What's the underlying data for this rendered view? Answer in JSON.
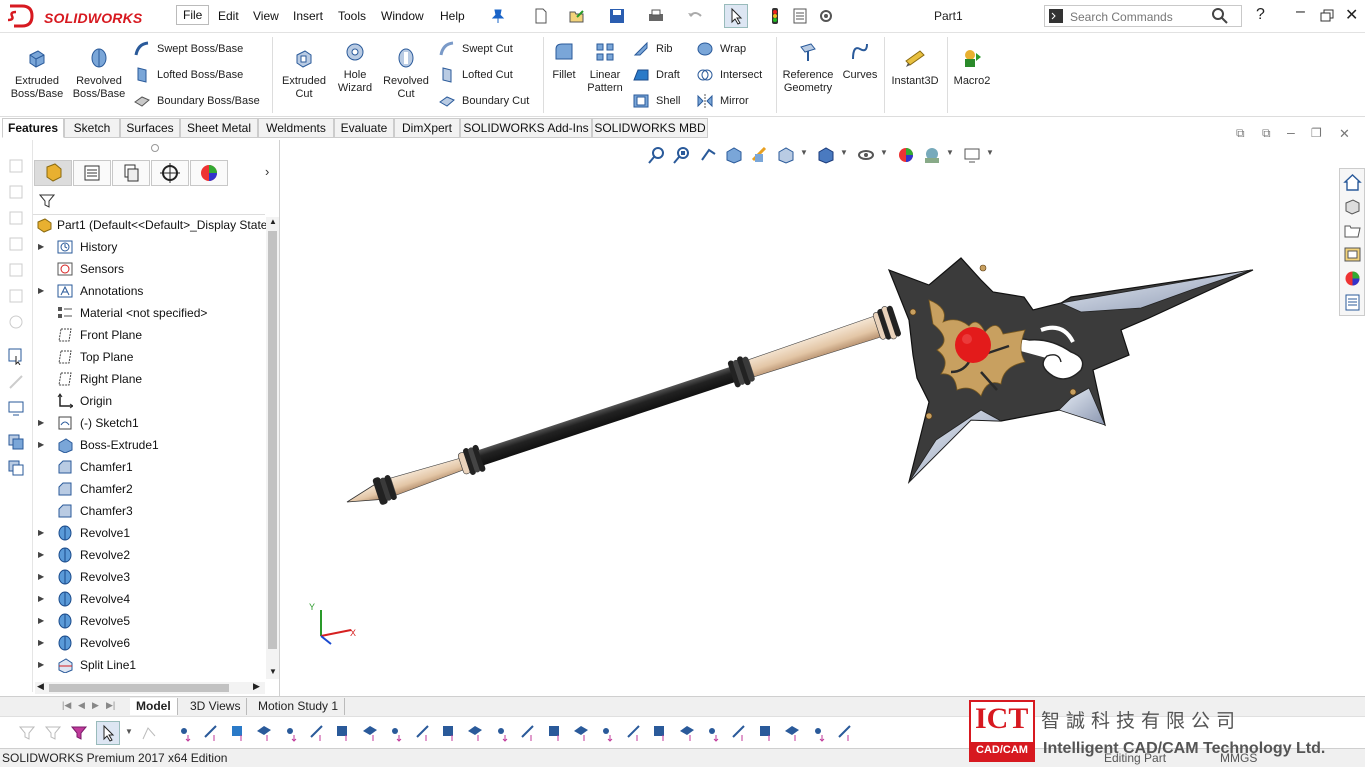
{
  "app": {
    "brand": "SOLIDWORKS",
    "document_title": "Part1",
    "edition": "SOLIDWORKS Premium 2017 x64 Edition",
    "status_mode": "Editing Part",
    "units": "MMGS"
  },
  "menu": [
    "File",
    "Edit",
    "View",
    "Insert",
    "Tools",
    "Window",
    "Help"
  ],
  "search": {
    "placeholder": "Search Commands"
  },
  "ribbon": {
    "extruded_boss": "Extruded Boss/Base",
    "revolved_boss": "Revolved Boss/Base",
    "swept_boss": "Swept Boss/Base",
    "lofted_boss": "Lofted Boss/Base",
    "boundary_boss": "Boundary Boss/Base",
    "extruded_cut": "Extruded Cut",
    "hole_wizard": "Hole Wizard",
    "revolved_cut": "Revolved Cut",
    "swept_cut": "Swept Cut",
    "lofted_cut": "Lofted Cut",
    "boundary_cut": "Boundary Cut",
    "fillet": "Fillet",
    "linear_pattern": "Linear Pattern",
    "rib": "Rib",
    "draft": "Draft",
    "shell": "Shell",
    "wrap": "Wrap",
    "intersect": "Intersect",
    "mirror": "Mirror",
    "reference_geometry": "Reference Geometry",
    "curves": "Curves",
    "instant3d": "Instant3D",
    "macro2": "Macro2"
  },
  "tabs": [
    "Features",
    "Sketch",
    "Surfaces",
    "Sheet Metal",
    "Weldments",
    "Evaluate",
    "DimXpert",
    "SOLIDWORKS Add-Ins",
    "SOLIDWORKS MBD"
  ],
  "tree": {
    "root": "Part1  (Default<<Default>_Display State",
    "items": [
      {
        "label": "History",
        "icon": "history-icon",
        "expand": true
      },
      {
        "label": "Sensors",
        "icon": "sensor-icon",
        "expand": false
      },
      {
        "label": "Annotations",
        "icon": "annotations-icon",
        "expand": true
      },
      {
        "label": "Material <not specified>",
        "icon": "material-icon",
        "expand": false
      },
      {
        "label": "Front Plane",
        "icon": "plane-icon",
        "expand": false
      },
      {
        "label": "Top Plane",
        "icon": "plane-icon",
        "expand": false
      },
      {
        "label": "Right Plane",
        "icon": "plane-icon",
        "expand": false
      },
      {
        "label": "Origin",
        "icon": "origin-icon",
        "expand": false
      },
      {
        "label": "(-) Sketch1",
        "icon": "sketch-icon",
        "expand": true
      },
      {
        "label": "Boss-Extrude1",
        "icon": "extrude-icon",
        "expand": true
      },
      {
        "label": "Chamfer1",
        "icon": "chamfer-icon",
        "expand": false
      },
      {
        "label": "Chamfer2",
        "icon": "chamfer-icon",
        "expand": false
      },
      {
        "label": "Chamfer3",
        "icon": "chamfer-icon",
        "expand": false
      },
      {
        "label": "Revolve1",
        "icon": "revolve-icon",
        "expand": true
      },
      {
        "label": "Revolve2",
        "icon": "revolve-icon",
        "expand": true
      },
      {
        "label": "Revolve3",
        "icon": "revolve-icon",
        "expand": true
      },
      {
        "label": "Revolve4",
        "icon": "revolve-icon",
        "expand": true
      },
      {
        "label": "Revolve5",
        "icon": "revolve-icon",
        "expand": true
      },
      {
        "label": "Revolve6",
        "icon": "revolve-icon",
        "expand": true
      },
      {
        "label": "Split Line1",
        "icon": "split-line-icon",
        "expand": true
      }
    ]
  },
  "bottom_tabs": [
    "Model",
    "3D Views",
    "Motion Study 1"
  ],
  "watermark": {
    "logo": "ICT",
    "logo_sub": "CAD/CAM",
    "chinese": "智誠科技有限公司",
    "english": "Intelligent CAD/CAM Technology Ltd."
  },
  "colors": {
    "brand_red": "#d71920",
    "accent_blue": "#1a64c8",
    "gem_red": "#e31b1b",
    "gold": "#c8a060"
  }
}
